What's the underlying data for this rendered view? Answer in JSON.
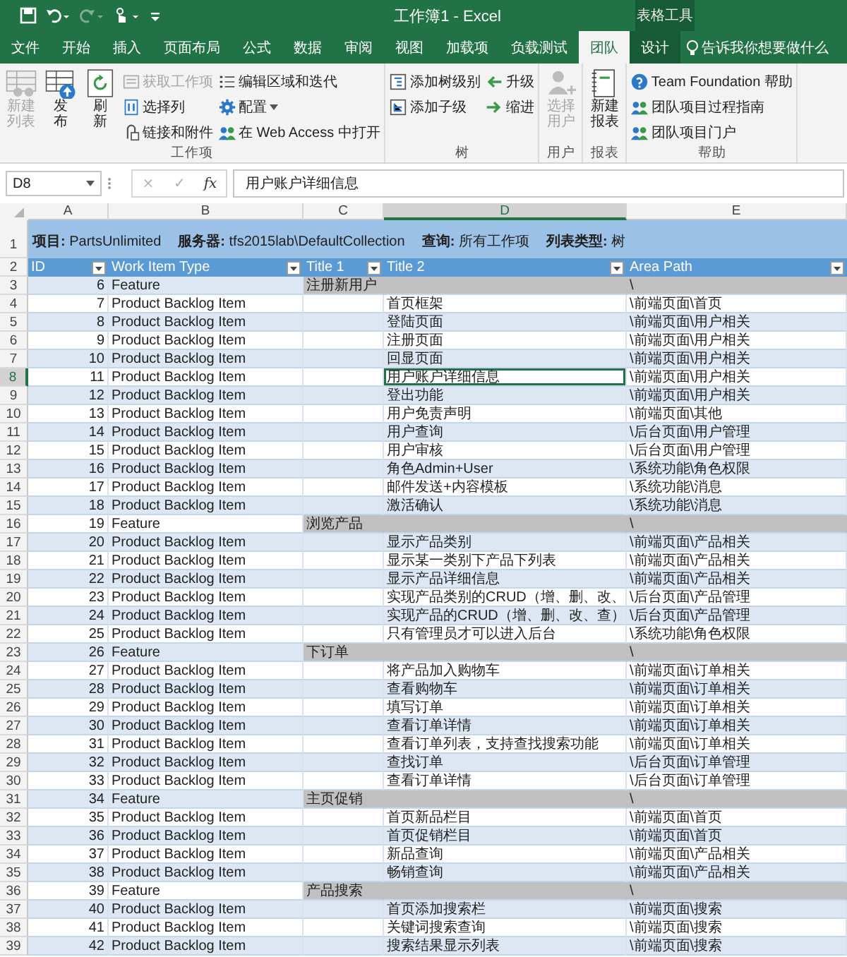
{
  "title_bar": {
    "title": "工作簿1 - Excel",
    "context_tab": "表格工具"
  },
  "ribbon_tabs": [
    {
      "label": "文件",
      "selected": false,
      "contextual": false
    },
    {
      "label": "开始",
      "selected": false,
      "contextual": false
    },
    {
      "label": "插入",
      "selected": false,
      "contextual": false
    },
    {
      "label": "页面布局",
      "selected": false,
      "contextual": false
    },
    {
      "label": "公式",
      "selected": false,
      "contextual": false
    },
    {
      "label": "数据",
      "selected": false,
      "contextual": false
    },
    {
      "label": "审阅",
      "selected": false,
      "contextual": false
    },
    {
      "label": "视图",
      "selected": false,
      "contextual": false
    },
    {
      "label": "加载项",
      "selected": false,
      "contextual": false
    },
    {
      "label": "负载测试",
      "selected": false,
      "contextual": false
    },
    {
      "label": "团队",
      "selected": true,
      "contextual": false
    },
    {
      "label": "设计",
      "selected": false,
      "contextual": true
    }
  ],
  "tell_me": {
    "placeholder": "告诉我你想要做什么"
  },
  "ribbon_groups": [
    {
      "label": "工作项",
      "large_buttons": [
        {
          "label": "新建列表",
          "disabled": true
        },
        {
          "label": "发布",
          "disabled": false
        },
        {
          "label": "刷新",
          "disabled": false
        }
      ],
      "small_columns": [
        [
          {
            "label": "获取工作项",
            "disabled": true,
            "dropdown": false
          },
          {
            "label": "选择列",
            "disabled": false,
            "dropdown": false
          },
          {
            "label": "链接和附件",
            "disabled": false,
            "dropdown": false
          }
        ],
        [
          {
            "label": "编辑区域和迭代",
            "disabled": false,
            "dropdown": false
          },
          {
            "label": "配置",
            "disabled": false,
            "dropdown": true
          },
          {
            "label": "在 Web Access 中打开",
            "disabled": false,
            "dropdown": false
          }
        ]
      ]
    },
    {
      "label": "树",
      "small_columns": [
        [
          {
            "label": "添加树级别",
            "disabled": false,
            "dropdown": false
          },
          {
            "label": "添加子级",
            "disabled": false,
            "dropdown": false
          }
        ],
        [
          {
            "label": "升级",
            "disabled": false,
            "dropdown": false
          },
          {
            "label": "缩进",
            "disabled": false,
            "dropdown": false
          }
        ]
      ]
    },
    {
      "label": "用户",
      "large_buttons": [
        {
          "label": "选择用户",
          "disabled": true
        }
      ]
    },
    {
      "label": "报表",
      "large_buttons": [
        {
          "label": "新建报表",
          "disabled": false
        }
      ]
    },
    {
      "label": "帮助",
      "small_columns": [
        [
          {
            "label": "Team Foundation 帮助",
            "disabled": false,
            "dropdown": false
          },
          {
            "label": "团队项目过程指南",
            "disabled": false,
            "dropdown": false
          },
          {
            "label": "团队项目门户",
            "disabled": false,
            "dropdown": false
          }
        ]
      ]
    }
  ],
  "formula_bar": {
    "name_box": "D8",
    "buttons": [
      {
        "label": "×",
        "disabled": true
      },
      {
        "label": "✓",
        "disabled": true
      },
      {
        "label": "fx",
        "disabled": false
      }
    ],
    "value": "用户账户详细信息"
  },
  "sheet": {
    "columns": [
      {
        "letter": "A",
        "selected": false
      },
      {
        "letter": "B",
        "selected": false
      },
      {
        "letter": "C",
        "selected": false
      },
      {
        "letter": "D",
        "selected": true
      },
      {
        "letter": "E",
        "selected": false
      }
    ],
    "info_row": {
      "row": "1",
      "items": [
        "**项目:** PartsUnlimited",
        "**服务器:** tfs2015lab\\DefaultCollection",
        "**查询:** 所有工作项",
        "**列表类型:** 树"
      ]
    },
    "header_row": {
      "row": "2",
      "headers": [
        "ID",
        "Work Item Type",
        "Title 1",
        "Title 2",
        "Area Path"
      ]
    },
    "rows": [
      {
        "row": "3",
        "kind": "feature",
        "id": "6",
        "type": "Feature",
        "title": "注册新用户",
        "area_path": "\\",
        "selected": false
      },
      {
        "row": "4",
        "kind": "item",
        "id": "7",
        "type": "Product Backlog Item",
        "title": "首页框架",
        "area_path": "\\前端页面\\首页",
        "selected": false
      },
      {
        "row": "5",
        "kind": "item",
        "id": "8",
        "type": "Product Backlog Item",
        "title": "登陆页面",
        "area_path": "\\前端页面\\用户相关",
        "selected": false
      },
      {
        "row": "6",
        "kind": "item",
        "id": "9",
        "type": "Product Backlog Item",
        "title": "注册页面",
        "area_path": "\\前端页面\\用户相关",
        "selected": false
      },
      {
        "row": "7",
        "kind": "item",
        "id": "10",
        "type": "Product Backlog Item",
        "title": "回显页面",
        "area_path": "\\前端页面\\用户相关",
        "selected": false
      },
      {
        "row": "8",
        "kind": "item",
        "id": "11",
        "type": "Product Backlog Item",
        "title": "用户账户详细信息",
        "area_path": "\\前端页面\\用户相关",
        "selected": true
      },
      {
        "row": "9",
        "kind": "item",
        "id": "12",
        "type": "Product Backlog Item",
        "title": "登出功能",
        "area_path": "\\前端页面\\用户相关",
        "selected": false
      },
      {
        "row": "10",
        "kind": "item",
        "id": "13",
        "type": "Product Backlog Item",
        "title": "用户免责声明",
        "area_path": "\\前端页面\\其他",
        "selected": false
      },
      {
        "row": "11",
        "kind": "item",
        "id": "14",
        "type": "Product Backlog Item",
        "title": "用户查询",
        "area_path": "\\后台页面\\用户管理",
        "selected": false
      },
      {
        "row": "12",
        "kind": "item",
        "id": "15",
        "type": "Product Backlog Item",
        "title": "用户审核",
        "area_path": "\\后台页面\\用户管理",
        "selected": false
      },
      {
        "row": "13",
        "kind": "item",
        "id": "16",
        "type": "Product Backlog Item",
        "title": "角色Admin+User",
        "area_path": "\\系统功能\\角色权限",
        "selected": false
      },
      {
        "row": "14",
        "kind": "item",
        "id": "17",
        "type": "Product Backlog Item",
        "title": "邮件发送+内容模板",
        "area_path": "\\系统功能\\消息",
        "selected": false
      },
      {
        "row": "15",
        "kind": "item",
        "id": "18",
        "type": "Product Backlog Item",
        "title": "激活确认",
        "area_path": "\\系统功能\\消息",
        "selected": false
      },
      {
        "row": "16",
        "kind": "feature",
        "id": "19",
        "type": "Feature",
        "title": "浏览产品",
        "area_path": "\\",
        "selected": false
      },
      {
        "row": "17",
        "kind": "item",
        "id": "20",
        "type": "Product Backlog Item",
        "title": "显示产品类别",
        "area_path": "\\前端页面\\产品相关",
        "selected": false
      },
      {
        "row": "18",
        "kind": "item",
        "id": "21",
        "type": "Product Backlog Item",
        "title": "显示某一类别下产品下列表",
        "area_path": "\\前端页面\\产品相关",
        "selected": false
      },
      {
        "row": "19",
        "kind": "item",
        "id": "22",
        "type": "Product Backlog Item",
        "title": "显示产品详细信息",
        "area_path": "\\前端页面\\产品相关",
        "selected": false
      },
      {
        "row": "20",
        "kind": "item",
        "id": "23",
        "type": "Product Backlog Item",
        "title": "实现产品类别的CRUD（增、删、改、",
        "area_path": "\\后台页面\\产品管理",
        "selected": false
      },
      {
        "row": "21",
        "kind": "item",
        "id": "24",
        "type": "Product Backlog Item",
        "title": "实现产品的CRUD（增、删、改、查）",
        "area_path": "\\后台页面\\产品管理",
        "selected": false
      },
      {
        "row": "22",
        "kind": "item",
        "id": "25",
        "type": "Product Backlog Item",
        "title": "只有管理员才可以进入后台",
        "area_path": "\\系统功能\\角色权限",
        "selected": false
      },
      {
        "row": "23",
        "kind": "feature",
        "id": "26",
        "type": "Feature",
        "title": "下订单",
        "area_path": "\\",
        "selected": false
      },
      {
        "row": "24",
        "kind": "item",
        "id": "27",
        "type": "Product Backlog Item",
        "title": "将产品加入购物车",
        "area_path": "\\前端页面\\订单相关",
        "selected": false
      },
      {
        "row": "25",
        "kind": "item",
        "id": "28",
        "type": "Product Backlog Item",
        "title": "查看购物车",
        "area_path": "\\前端页面\\订单相关",
        "selected": false
      },
      {
        "row": "26",
        "kind": "item",
        "id": "29",
        "type": "Product Backlog Item",
        "title": "填写订单",
        "area_path": "\\前端页面\\订单相关",
        "selected": false
      },
      {
        "row": "27",
        "kind": "item",
        "id": "30",
        "type": "Product Backlog Item",
        "title": "查看订单详情",
        "area_path": "\\前端页面\\订单相关",
        "selected": false
      },
      {
        "row": "28",
        "kind": "item",
        "id": "31",
        "type": "Product Backlog Item",
        "title": "查看订单列表，支持查找搜索功能",
        "area_path": "\\前端页面\\订单相关",
        "selected": false
      },
      {
        "row": "29",
        "kind": "item",
        "id": "32",
        "type": "Product Backlog Item",
        "title": "查找订单",
        "area_path": "\\后台页面\\订单管理",
        "selected": false
      },
      {
        "row": "30",
        "kind": "item",
        "id": "33",
        "type": "Product Backlog Item",
        "title": "查看订单详情",
        "area_path": "\\后台页面\\订单管理",
        "selected": false
      },
      {
        "row": "31",
        "kind": "feature",
        "id": "34",
        "type": "Feature",
        "title": "主页促销",
        "area_path": "\\",
        "selected": false
      },
      {
        "row": "32",
        "kind": "item",
        "id": "35",
        "type": "Product Backlog Item",
        "title": "首页新品栏目",
        "area_path": "\\前端页面\\首页",
        "selected": false
      },
      {
        "row": "33",
        "kind": "item",
        "id": "36",
        "type": "Product Backlog Item",
        "title": "首页促销栏目",
        "area_path": "\\前端页面\\首页",
        "selected": false
      },
      {
        "row": "34",
        "kind": "item",
        "id": "37",
        "type": "Product Backlog Item",
        "title": "新品查询",
        "area_path": "\\前端页面\\产品相关",
        "selected": false
      },
      {
        "row": "35",
        "kind": "item",
        "id": "38",
        "type": "Product Backlog Item",
        "title": "畅销查询",
        "area_path": "\\前端页面\\产品相关",
        "selected": false
      },
      {
        "row": "36",
        "kind": "feature",
        "id": "39",
        "type": "Feature",
        "title": "产品搜索",
        "area_path": "\\",
        "selected": false
      },
      {
        "row": "37",
        "kind": "item",
        "id": "40",
        "type": "Product Backlog Item",
        "title": "首页添加搜索栏",
        "area_path": "\\前端页面\\搜索",
        "selected": false
      },
      {
        "row": "38",
        "kind": "item",
        "id": "41",
        "type": "Product Backlog Item",
        "title": "关键词搜索查询",
        "area_path": "\\前端页面\\搜索",
        "selected": false
      },
      {
        "row": "39",
        "kind": "item",
        "id": "42",
        "type": "Product Backlog Item",
        "title": "搜索结果显示列表",
        "area_path": "\\前端页面\\搜索",
        "selected": false
      }
    ]
  }
}
